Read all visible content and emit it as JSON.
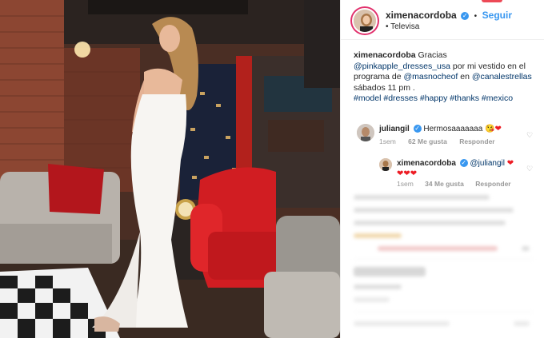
{
  "post": {
    "username": "ximenacordoba",
    "follow_label": "Seguir",
    "location": "Televisa",
    "verified_mark": "✓"
  },
  "caption": {
    "username": "ximenacordoba",
    "part1": "Gracias",
    "mention1": "@pinkapple_dresses_usa",
    "part2": "por mi vestido en el programa de",
    "mention2": "@masnocheof",
    "part3": "en",
    "mention3": "@canalestrellas",
    "part4": "sábados 11 pm .",
    "hashtags": "#model #dresses #happy #thanks #mexico"
  },
  "comments": [
    {
      "username": "juliangil",
      "text": "Hermosaaaaaaa",
      "emoji": "😘❤",
      "time": "1sem",
      "likes": "62 Me gusta",
      "reply": "Responder"
    },
    {
      "username": "ximenacordoba",
      "mention": "@juliangil",
      "hearts": "❤❤❤❤",
      "time": "1sem",
      "likes": "34 Me gusta",
      "reply": "Responder"
    }
  ],
  "icons": {
    "heart_outline": "♡"
  },
  "colors": {
    "accent_blue": "#3897f0",
    "link": "#003569",
    "heart_red": "#ed1c24",
    "muted": "#999999"
  }
}
